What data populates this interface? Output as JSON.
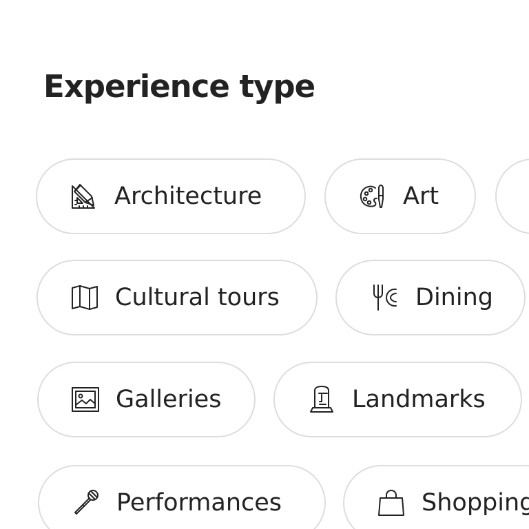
{
  "section": {
    "title": "Experience type"
  },
  "chips": [
    {
      "label": "Architecture",
      "icon": "architecture-icon"
    },
    {
      "label": "Art",
      "icon": "palette-icon"
    },
    {
      "label": "Cultural tours",
      "icon": "map-icon"
    },
    {
      "label": "Dining",
      "icon": "fork-plate-icon"
    },
    {
      "label": "Galleries",
      "icon": "framed-picture-icon"
    },
    {
      "label": "Landmarks",
      "icon": "moai-statue-icon"
    },
    {
      "label": "Performances",
      "icon": "microphone-icon"
    },
    {
      "label": "Shopping",
      "icon": "shopping-bag-icon"
    }
  ],
  "colors": {
    "text": "#222222",
    "chip_border": "#dddddd",
    "background": "#ffffff"
  }
}
